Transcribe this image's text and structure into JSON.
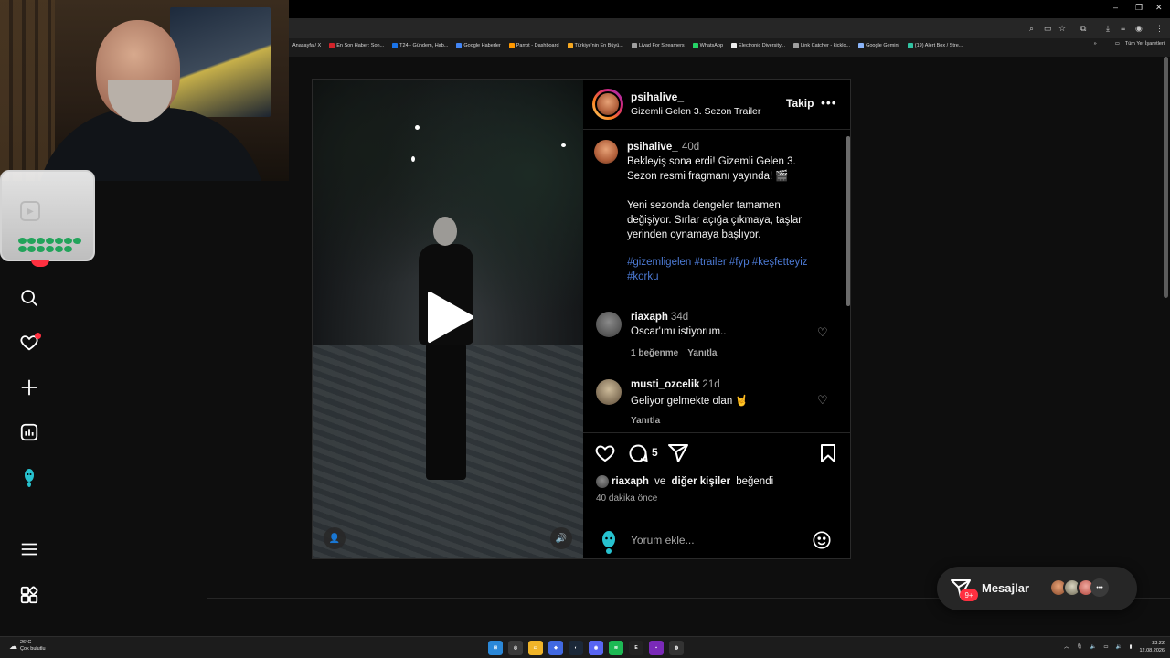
{
  "browser": {
    "window_controls": [
      "–",
      "❐",
      "✕"
    ],
    "bookmarks": [
      {
        "label": "Anasayfa / X",
        "color": "#000000"
      },
      {
        "label": "En Son Haber: Son...",
        "color": "#d2232a"
      },
      {
        "label": "T24 - Gündem, Hab...",
        "color": "#1a73e8"
      },
      {
        "label": "Google Haberler",
        "color": "#4285f4"
      },
      {
        "label": "Parrot - Dashboard",
        "color": "#ff9800"
      },
      {
        "label": "Türkiye'nin En Büyü...",
        "color": "#f6a821"
      },
      {
        "label": "Livad For Streamers",
        "color": "#9e9e9e"
      },
      {
        "label": "WhatsApp",
        "color": "#25d366"
      },
      {
        "label": "Electronic Diversity...",
        "color": "#eeeeee"
      },
      {
        "label": "Link Catcher - kicklo...",
        "color": "#9e9e9e"
      },
      {
        "label": "Google Gemini",
        "color": "#8ab4f8"
      },
      {
        "label": "(19) Alert Box / Stre...",
        "color": "#31c3a2"
      }
    ],
    "bookmarks_more": "»",
    "all_bookmarks": "Tüm Yer İşaretleri"
  },
  "post": {
    "username": "psihalive_",
    "subtitle": "Gizemli Gelen 3. Sezon Trailer",
    "follow_label": "Takip",
    "more_label": "•••",
    "caption": {
      "username": "psihalive_",
      "time": "40d",
      "body": "Bekleyiş sona erdi! Gizemli Gelen 3. Sezon resmi fragmanı yayında! 🎬\n\nYeni sezonda dengeler tamamen değişiyor. Sırlar açığa çıkmaya, taşlar yerinden oynamaya başlıyor.",
      "hashtags": "#gizemligelen #trailer #fyp #keşfetteyiz #korku"
    },
    "comments": [
      {
        "username": "riaxaph",
        "time": "34d",
        "text": "Oscar'ımı istiyorum..",
        "likes_label": "1 beğenme",
        "reply_label": "Yanıtla"
      },
      {
        "username": "musti_ozcelik",
        "time": "21d",
        "text": "Geliyor gelmekte olan 🤘",
        "likes_label": "",
        "reply_label": "Yanıtla"
      }
    ],
    "comment_count": "5",
    "liked_by_user": "riaxaph",
    "liked_by_connector": " ve ",
    "liked_by_others": "diğer kişiler",
    "liked_by_suffix": " beğendi",
    "time_ago": "40 dakika önce",
    "comment_placeholder": "Yorum ekle..."
  },
  "messages": {
    "label": "Mesajlar",
    "badge": "9+",
    "more": "•••"
  },
  "taskbar": {
    "temperature": "26°C",
    "weather": "Çok bulutlu",
    "time": "23:22",
    "date": "12.08.2026"
  },
  "colors": {
    "accent_like": "#ff3040",
    "hashtag": "#4d7bd6",
    "background": "#000000"
  }
}
